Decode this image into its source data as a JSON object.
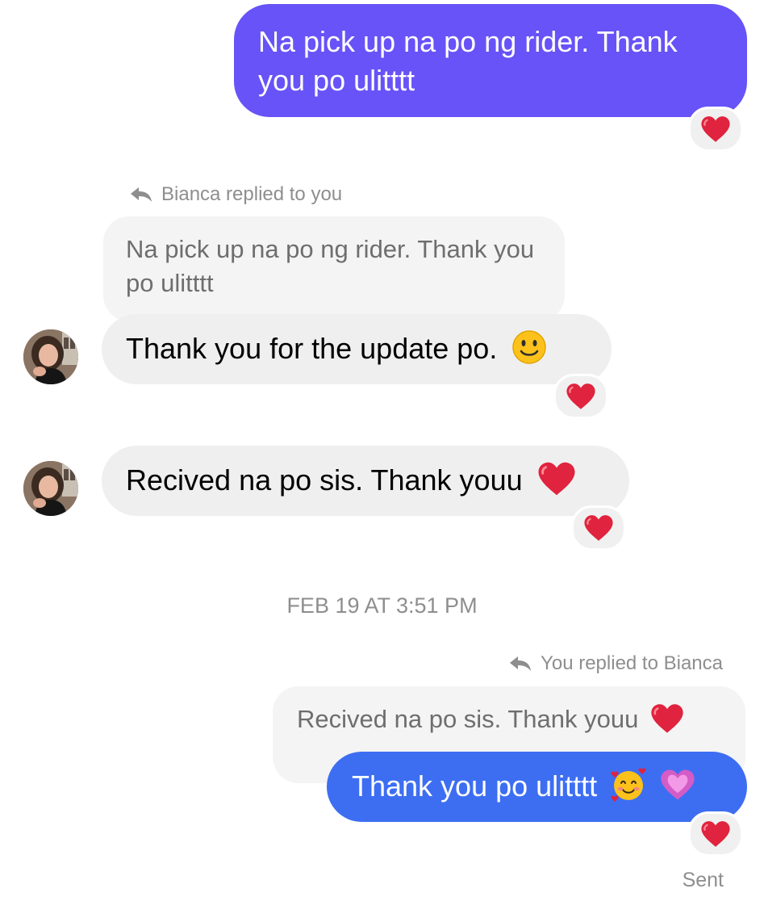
{
  "messages": {
    "m1_text": "Na pick up na po ng rider. Thank you po ulitttt",
    "m2_reply_label": "Bianca replied to you",
    "m2_quote": "Na pick up na po ng rider. Thank you po ulitttt",
    "m2_text": "Thank you for the update po.",
    "m3_text": "Recived na po sis. Thank youu",
    "timestamp": "FEB 19 AT 3:51 PM",
    "m4_reply_label": "You replied to Bianca",
    "m4_quote": "Recived na po sis. Thank youu",
    "m4_text": "Thank you po ulitttt",
    "status": "Sent"
  },
  "reactions": {
    "emoji_name": "red-heart",
    "color": "#e0233e"
  },
  "colors": {
    "outgoing_purple": "#6753f7",
    "outgoing_blue": "#3d6ef2",
    "incoming_gray": "#efefef",
    "meta_gray": "#8e8e8e"
  }
}
